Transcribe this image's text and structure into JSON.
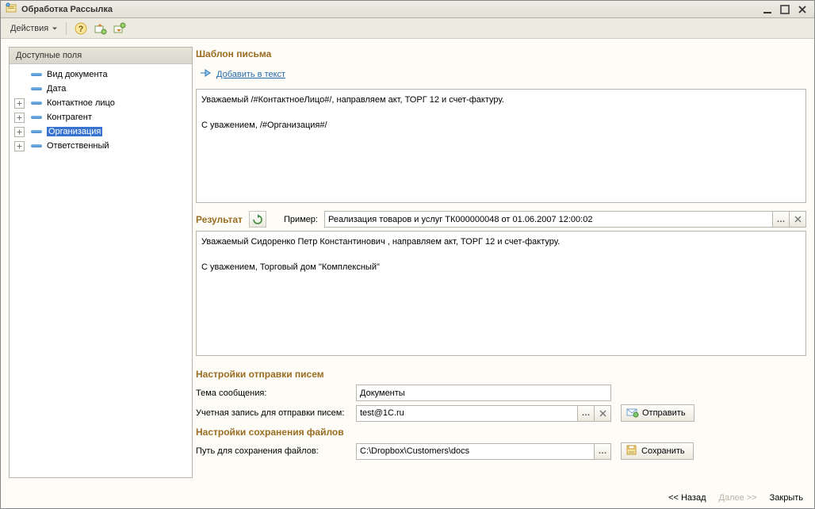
{
  "window": {
    "title": "Обработка  Рассылка"
  },
  "toolbar": {
    "actions": "Действия"
  },
  "sidebar": {
    "header": "Доступные поля",
    "items": [
      {
        "label": "Вид документа",
        "expandable": false
      },
      {
        "label": "Дата",
        "expandable": false
      },
      {
        "label": "Контактное лицо",
        "expandable": true
      },
      {
        "label": "Контрагент",
        "expandable": true
      },
      {
        "label": "Организация",
        "expandable": true,
        "selected": true
      },
      {
        "label": "Ответственный",
        "expandable": true
      }
    ]
  },
  "template": {
    "title": "Шаблон письма",
    "add_link": "Добавить в текст",
    "body": "Уважаемый /#КонтактноеЛицо#/, направляем акт, ТОРГ 12 и счет-фактуру.\n\nС уважением, /#Организация#/"
  },
  "result": {
    "title": "Результат",
    "example_label": "Пример:",
    "example_value": "Реализация товаров и услуг ТК000000048 от 01.06.2007 12:00:02",
    "body": "Уважаемый Сидоренко Петр Константинович , направляем акт, ТОРГ 12 и счет-фактуру.\n\nС уважением, Торговый дом \"Комплексный\""
  },
  "mail_settings": {
    "title": "Настройки отправки писем",
    "subject_label": "Тема сообщения:",
    "subject_value": "Документы",
    "account_label": "Учетная запись для отправки писем:",
    "account_value": "test@1C.ru",
    "send_button": "Отправить"
  },
  "file_settings": {
    "title": "Настройки сохранения файлов",
    "path_label": "Путь для сохранения файлов:",
    "path_value": "C:\\Dropbox\\Customers\\docs",
    "save_button": "Сохранить"
  },
  "footer": {
    "back": "<< Назад",
    "next": "Далее >>",
    "close": "Закрыть"
  }
}
